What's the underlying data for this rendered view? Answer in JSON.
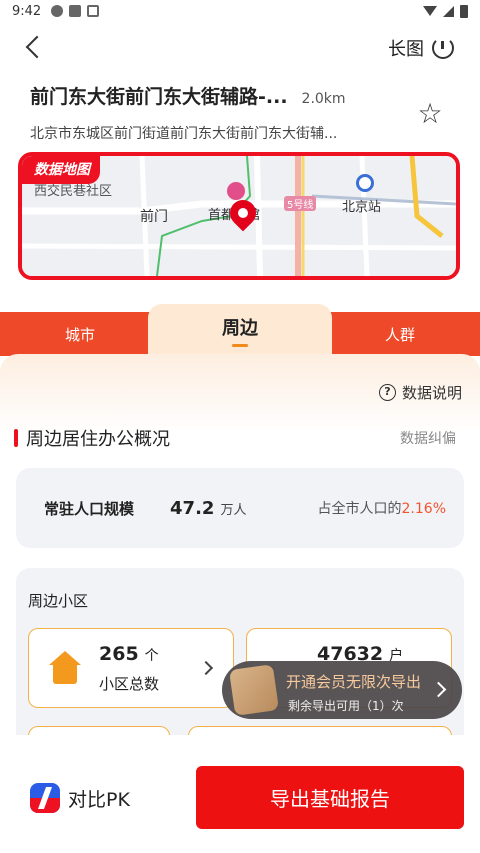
{
  "status_bar": {
    "time": "9:42",
    "left_icons": [
      "wechat-icon",
      "sync-icon",
      "notification-icon"
    ],
    "right_icons": [
      "wifi-icon",
      "signal-icon",
      "battery-icon"
    ]
  },
  "topbar": {
    "long_image_label": "长图"
  },
  "location": {
    "title": "前门东大街前门东大街辅路-...",
    "distance": "2.0km",
    "subtitle": "北京市东城区前门街道前门东大街前门东大街辅..."
  },
  "map": {
    "tag": "数据地图",
    "labels": {
      "community": "西交民巷社区",
      "qianmen": "前门",
      "hotel": "首都宾馆",
      "line5": "5号线",
      "station": "北京站"
    }
  },
  "tabs": [
    {
      "label": "城市",
      "active": false
    },
    {
      "label": "周边",
      "active": true
    },
    {
      "label": "人群",
      "active": false
    }
  ],
  "data_description": "数据说明",
  "section": {
    "title": "周边居住办公概况",
    "correction": "数据纠偏"
  },
  "population": {
    "label": "常驻人口规模",
    "value": "47.2",
    "unit": "万人",
    "ratio_prefix": "占全市人口的",
    "ratio_value": "2.16%"
  },
  "nearby": {
    "title": "周边小区",
    "stats": [
      {
        "value": "265",
        "unit": "个",
        "label": "小区总数"
      },
      {
        "value": "47632",
        "unit": "户",
        "label": ""
      }
    ]
  },
  "promo": {
    "main": "开通会员无限次导出",
    "sub": "剩余导出可用（1）次"
  },
  "bottom": {
    "compare_label": "对比PK",
    "export_label": "导出基础报告"
  }
}
